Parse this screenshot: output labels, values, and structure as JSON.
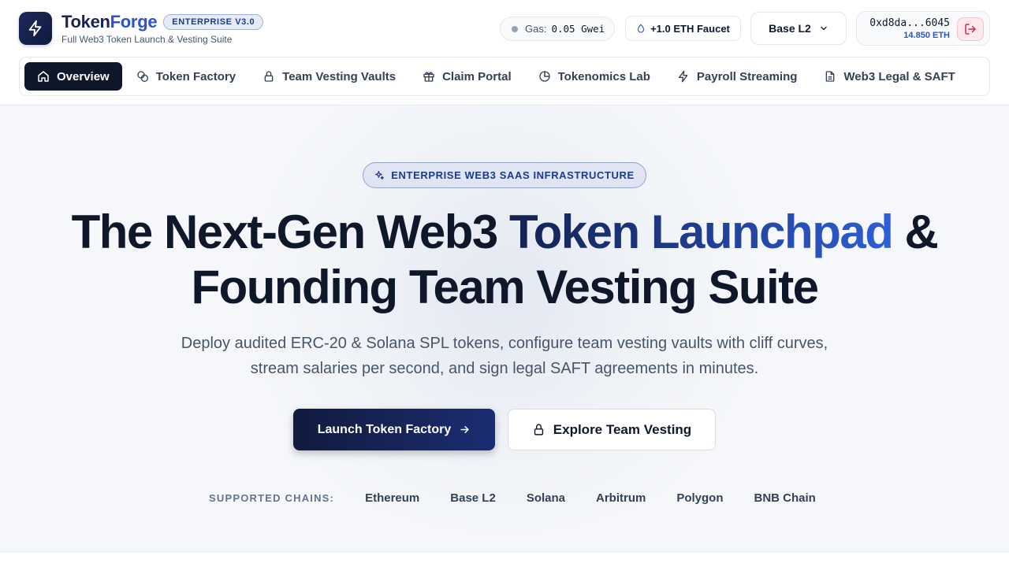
{
  "brand": {
    "name_part1": "Token",
    "name_part2": "Forge",
    "version_badge": "ENTERPRISE V3.0",
    "subtitle": "Full Web3 Token Launch & Vesting Suite",
    "logo_icon": "lightning-bolt-icon"
  },
  "header": {
    "gas_label": "Gas:",
    "gas_value": "0.05 Gwei",
    "faucet_label": "+1.0 ETH Faucet",
    "chain_selected": "Base L2",
    "wallet_address": "0xd8da...6045",
    "wallet_balance": "14.850 ETH"
  },
  "nav": {
    "items": [
      {
        "label": "Overview",
        "icon": "home-icon",
        "active": true
      },
      {
        "label": "Token Factory",
        "icon": "coins-icon",
        "active": false
      },
      {
        "label": "Team Vesting Vaults",
        "icon": "lock-icon",
        "active": false
      },
      {
        "label": "Claim Portal",
        "icon": "gift-icon",
        "active": false
      },
      {
        "label": "Tokenomics Lab",
        "icon": "pie-chart-icon",
        "active": false
      },
      {
        "label": "Payroll Streaming",
        "icon": "zap-icon",
        "active": false
      },
      {
        "label": "Web3 Legal & SAFT",
        "icon": "document-icon",
        "active": false
      }
    ]
  },
  "hero": {
    "pill": "ENTERPRISE WEB3 SAAS INFRASTRUCTURE",
    "title_part1": "The Next-Gen Web3 ",
    "title_highlight": "Token Launchpad",
    "title_part2": " &",
    "title_line2": "Founding Team Vesting Suite",
    "description": "Deploy audited ERC-20 & Solana SPL tokens, configure team vesting vaults with cliff curves, stream salaries per second, and sign legal SAFT agreements in minutes.",
    "cta_primary": "Launch Token Factory",
    "cta_secondary": "Explore Team Vesting",
    "chains_label": "SUPPORTED CHAINS:",
    "chains": [
      "Ethereum",
      "Base L2",
      "Solana",
      "Arbitrum",
      "Polygon",
      "BNB Chain"
    ]
  },
  "colors": {
    "primary_dark": "#0f172a",
    "accent_blue": "#2a55c9",
    "logout_red": "#e11d48"
  }
}
